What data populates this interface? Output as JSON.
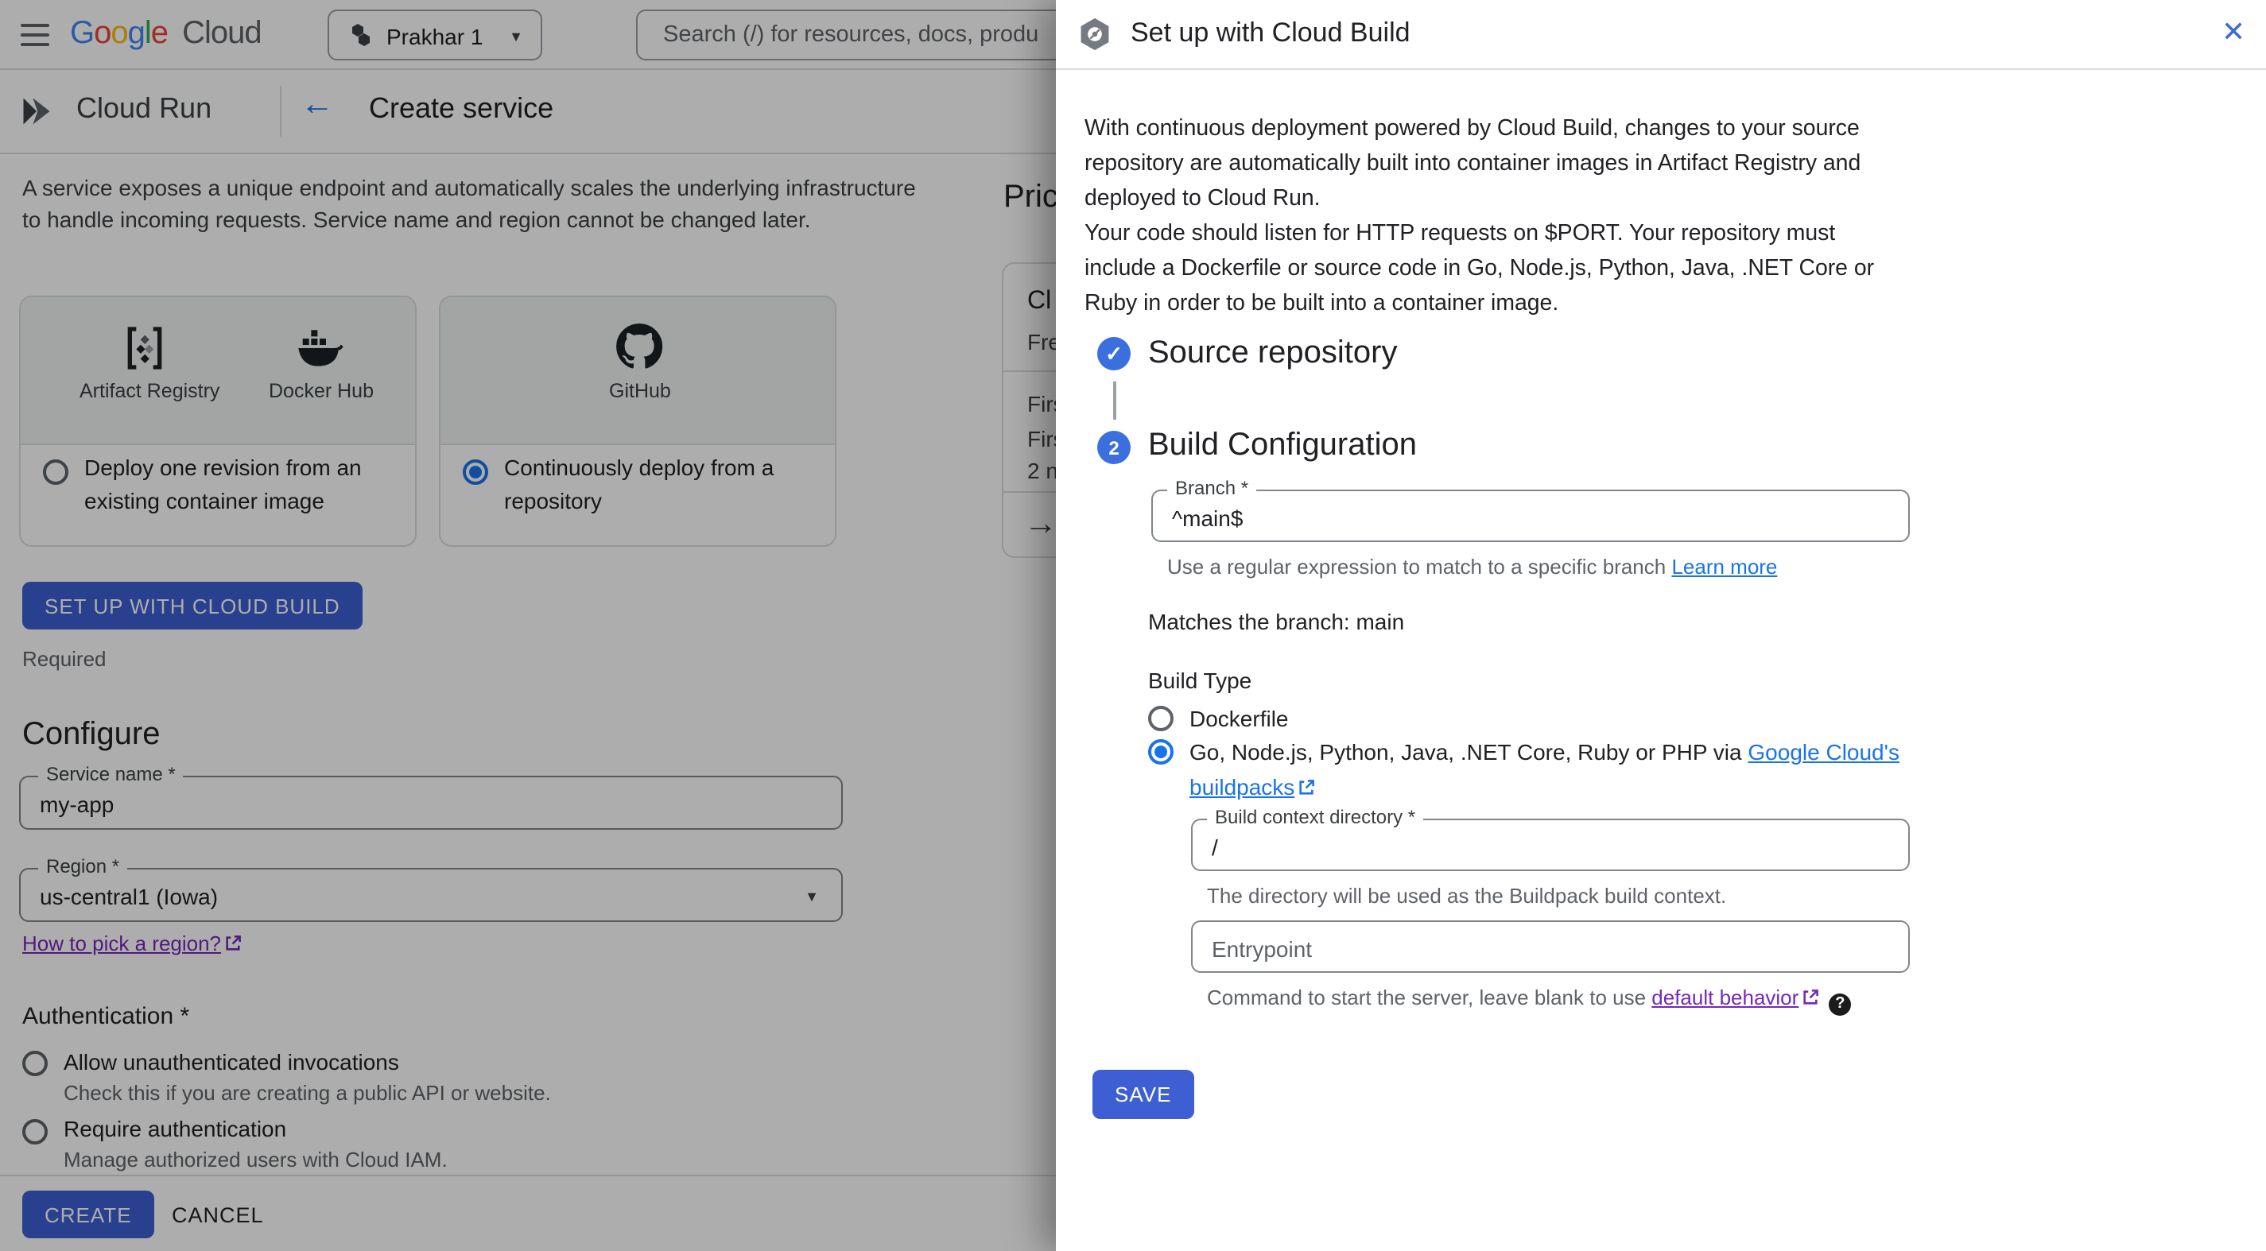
{
  "colors": {
    "primary_button": "#3d5fd3",
    "link_blue": "#1a73e8",
    "link_purple": "#7627bb",
    "step_circle": "#3c6fde",
    "close_blue": "#3e68d8"
  },
  "icons": {
    "back": "←",
    "caret_down": "▼",
    "close": "✕",
    "check": "✓",
    "arrow_right": "→",
    "help": "?"
  },
  "topbar": {
    "logo": {
      "g1": "G",
      "o1": "o",
      "o2": "o",
      "g2": "g",
      "l": "l",
      "e": "e",
      "cloud": "Cloud"
    },
    "project": "Prakhar 1",
    "search_placeholder": "Search (/) for resources, docs, produ"
  },
  "subheader": {
    "product": "Cloud Run",
    "title": "Create service"
  },
  "main": {
    "intro": "A service exposes a unique endpoint and automatically scales the underlying infrastructure to handle incoming requests. Service name and region cannot be changed later.",
    "cards": [
      {
        "label1": "Artifact Registry",
        "label2": "Docker Hub",
        "option": "Deploy one revision from an existing container image",
        "checked": false
      },
      {
        "label1": "GitHub",
        "option": "Continuously deploy from a repository",
        "checked": true
      }
    ],
    "setup_button": "SET UP WITH CLOUD BUILD",
    "required": "Required",
    "configure": {
      "heading": "Configure",
      "service_name_label": "Service name *",
      "service_name_value": "my-app",
      "region_label": "Region *",
      "region_value": "us-central1 (Iowa)",
      "region_link": "How to pick a region?"
    },
    "auth": {
      "heading": "Authentication *",
      "options": [
        {
          "label": "Allow unauthenticated invocations",
          "desc": "Check this if you are creating a public API or website."
        },
        {
          "label": "Require authentication",
          "desc": "Manage authorized users with Cloud IAM."
        }
      ]
    },
    "footer": {
      "create": "CREATE",
      "cancel": "CANCEL"
    }
  },
  "pricing": {
    "heading_fragment": "Pric",
    "frags": [
      "Cl",
      "Fre",
      "Firs",
      "Firs",
      "2 n"
    ]
  },
  "panel": {
    "title": "Set up with Cloud Build",
    "intro1": "With continuous deployment powered by Cloud Build, changes to your source repository are automatically built into container images in Artifact Registry and deployed to Cloud Run.",
    "intro2": "Your code should listen for HTTP requests on $PORT. Your repository must include a Dockerfile or source code in Go, Node.js, Python, Java, .NET Core or Ruby in order to be built into a container image.",
    "step1_title": "Source repository",
    "step2_number": "2",
    "step2_title": "Build Configuration",
    "branch_label": "Branch *",
    "branch_value": "^main$",
    "branch_help": "Use a regular expression to match to a specific branch ",
    "branch_help_link": "Learn more",
    "matches": "Matches the branch: main",
    "build_type_label": "Build Type",
    "radio_dockerfile": "Dockerfile",
    "radio_buildpacks_prefix": "Go, Node.js, Python, Java, .NET Core, Ruby or PHP via ",
    "radio_buildpacks_link": "Google Cloud's buildpacks",
    "context_label": "Build context directory *",
    "context_value": "/",
    "context_help": "The directory will be used as the Buildpack build context.",
    "entrypoint_placeholder": "Entrypoint",
    "entry_help_prefix": "Command to start the server, leave blank to use ",
    "entry_help_link": "default behavior",
    "save": "SAVE"
  }
}
